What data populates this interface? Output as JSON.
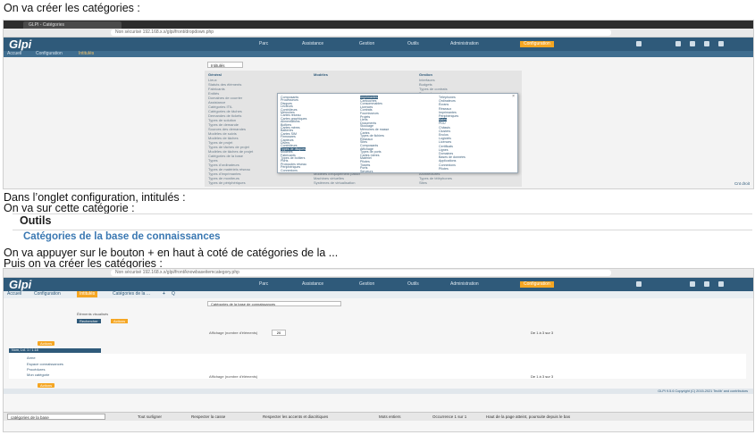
{
  "doc": {
    "line1": "On va créer les catégories :",
    "line2": "Dans l’onglet configuration, intitulés :",
    "line3": "On va sur cette catégorie :",
    "outils": "Outils",
    "categories_title": "Catégories de la base de connaissances",
    "line4": "On va appuyer sur le bouton + en haut à coté de catégories de la ...",
    "line5": "Puis on va créer les catégories :"
  },
  "shot1": {
    "tab_title": "GLPI - Catégories",
    "url": "Non sécurisé   192.168.x.x/glpi/front/dropdown.php",
    "logo": "Glpi",
    "menu": [
      "Parc",
      "Assistance",
      "Gestion",
      "Outils",
      "Administration",
      "Configuration"
    ],
    "active_menu": "Configuration",
    "breadcrumb": [
      "Accueil",
      "Configuration",
      "Intitulés"
    ],
    "section_filter": "Intitulés",
    "col_headers": [
      "Général",
      "Modèles",
      "Gestion"
    ],
    "left_rows": [
      "Lieux",
      "Statuts des éléments",
      "Fabricants",
      "Entités",
      "Domaines de courrier",
      "Assistance",
      "Catégories ITIL",
      "Catégories de tâches",
      "Demandes de tickets",
      "Types de solution",
      "Types de demande",
      "Sources des demandes",
      "Modèles de suivis",
      "Modèles de tâches",
      "Types de projet",
      "Types de tâches de projet",
      "Modèles de tâches de projet",
      "Catégories de la base",
      "Types",
      "Types d'ordinateurs",
      "Types de matériels réseau",
      "Types d'imprimantes",
      "Types de moniteurs",
      "Types de périphériques"
    ],
    "mid_rows": [
      "Modèles d'ordinateurs",
      "Modèles de matériels",
      "Modèles de téléphones",
      "Modèles d'imprimantes",
      "Modèles de moniteurs",
      "Modèles de périphériques",
      "Modèles de baies",
      "Modèles de PDU",
      "Modèles de châssis",
      "Modèles de capteurs",
      "Modèles de boîtes",
      "Modèles de câbles",
      "Modèles de PDU",
      "Modèles d'équipement passif",
      "Machines virtuelles",
      "Systèmes de virtualisation"
    ],
    "right_rows": [
      "Interfaces",
      "Budgets",
      "Types de contrats",
      "Types de contacts",
      "Fonctions",
      "Types de fournisseurs",
      "Types de documents",
      "Rubriques",
      "Types de certificats",
      "Réseau",
      "Interfaces",
      "Types de réseau",
      "Protocoles",
      "Adresses IP",
      "Câbles",
      "Types de câbles",
      "Connecteurs",
      "Édition",
      "Systèmes d'exploitation",
      "Versions",
      "Éditeurs",
      "Architectures",
      "Types de téléphones",
      "Sites"
    ],
    "dropdown_col1": [
      "Composants",
      "Processeurs",
      "Disques",
      "Lecteurs",
      "Contrôleurs",
      "Mémoires",
      "Cartes réseau",
      "Cartes graphiques",
      "Alimentations",
      "Boîtiers",
      "Cartes mères",
      "Batteries",
      "Cartes SIM",
      "Firmwares",
      "Capteurs",
      "Divers",
      "Contrôleurs",
      "Types de disques",
      "Modèles",
      "Fabricants",
      "Types de boîtiers",
      "Ports",
      "Protocoles réseau",
      "Périphériques",
      "Connexions"
    ],
    "dropdown_col2": [
      "Imprimantes",
      "Cartouches",
      "Consommables",
      "Licences",
      "Contrats",
      "Fournisseurs",
      "Projets",
      "Liens",
      "Documents",
      "Stockage",
      "Mémoires de masse",
      "Cartes",
      "Types de fichiers",
      "Réseaux",
      "Sites",
      "Composants",
      "Affichage",
      "Types de ports",
      "Cartes mères",
      "Matériel",
      "Pilotes",
      "Tickets",
      "Ports",
      "Serveurs"
    ],
    "dropdown_col3": [
      "Téléphones",
      "Ordinateurs",
      "Écrans",
      "Réseaux",
      "Imprimantes",
      "Périphériques",
      "Baies",
      "PDU",
      "Châssis",
      "Clusters",
      "Enclos",
      "Logiciels",
      "Licences",
      "Certificats",
      "Lignes",
      "Domaines",
      "Bases de données",
      "Applications",
      "Connexions",
      "Pilotes"
    ],
    "status_icons": "Cnt droit"
  },
  "shot2": {
    "url": "Non sécurisé   192.168.x.x/glpi/front/knowbaseitemcategory.php",
    "logo": "Glpi",
    "menu": [
      "Parc",
      "Assistance",
      "Gestion",
      "Outils",
      "Administration",
      "Configuration"
    ],
    "breadcrumb": [
      "Accueil",
      "Configuration",
      "Intitulés",
      "Catégories de la ..."
    ],
    "add_label": "+",
    "search_label": "Q",
    "filter_select": "Catégories de la base de connaissances",
    "criteria_label": "Éléments visualisés",
    "search_btn": "Rechercher",
    "actions_btn": "Actions",
    "pagination": "De 1 à 3 sur 3",
    "display_label": "Affichage (nombre d'éléments)",
    "display_value": "20",
    "tree_header": "Nom, Lvl. 1 / 1.18",
    "items": [
      "Arme",
      "Espace connaissances",
      "Procédures",
      "Mon catégorie"
    ],
    "footer_left": "GLPI 9.5.6 Copyright (C) 2015-2021 Teclib' and contributors",
    "find_bar": {
      "input_value": "catégories de la base",
      "options": [
        "Tout surligner",
        "Respecter la casse",
        "Respecter les accents et diacritiques",
        "Mots entiers"
      ],
      "result": "Occurrence 1 sur 1",
      "hint": "Haut de la page atteint, poursuite depuis le bas"
    }
  }
}
